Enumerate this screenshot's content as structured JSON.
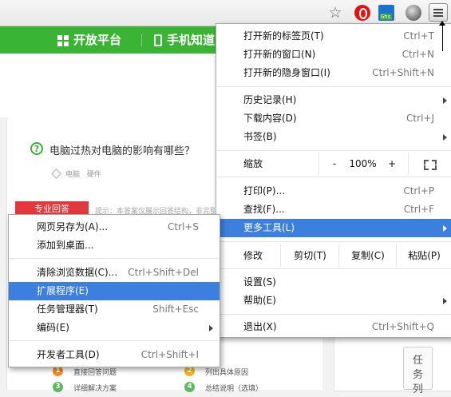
{
  "toolbar": {
    "star_icon": "star-bookmark-icon",
    "ext2_badge": "Ghs"
  },
  "site_nav": {
    "open_platform": "开放平台",
    "mobile_zhidao": "手机知道"
  },
  "question": {
    "title": "电脑过热对电脑的影响有哪些？",
    "tags": [
      "电脑",
      "硬件"
    ]
  },
  "answer": {
    "pro_tab": "专业回答",
    "hint": "提示：本答案仅展示回答结构，非完整"
  },
  "sidebar": {
    "task_button": "任务列"
  },
  "answer_steps": [
    {
      "num": "1",
      "text": "直接回答问题",
      "color": "#f08a24"
    },
    {
      "num": "2",
      "text": "列出具体原因",
      "color": "#f2b41c"
    },
    {
      "num": "3",
      "text": "详细解决方案",
      "color": "#5cb85c"
    },
    {
      "num": "4",
      "text": "总结说明（选填）",
      "color": "#5cb85c"
    }
  ],
  "chrome_menu": {
    "new_tab": {
      "label": "打开新的标签页(T)",
      "shortcut": "Ctrl+T"
    },
    "new_window": {
      "label": "打开新的窗口(N)",
      "shortcut": "Ctrl+N"
    },
    "new_incognito": {
      "label": "打开新的隐身窗口(I)",
      "shortcut": "Ctrl+Shift+N"
    },
    "history": {
      "label": "历史记录(H)"
    },
    "downloads": {
      "label": "下载内容(D)",
      "shortcut": "Ctrl+J"
    },
    "bookmarks": {
      "label": "书签(B)"
    },
    "zoom": {
      "label": "缩放",
      "minus": "-",
      "value": "100%",
      "plus": "+"
    },
    "print": {
      "label": "打印(P)...",
      "shortcut": "Ctrl+P"
    },
    "find": {
      "label": "查找(F)...",
      "shortcut": "Ctrl+F"
    },
    "more_tools": {
      "label": "更多工具(L)"
    },
    "edit": {
      "label": "修改",
      "cut": "剪切(T)",
      "copy": "复制(C)",
      "paste": "粘贴(P)"
    },
    "settings": {
      "label": "设置(S)"
    },
    "help": {
      "label": "帮助(E)"
    },
    "exit": {
      "label": "退出(X)",
      "shortcut": "Ctrl+Shift+Q"
    }
  },
  "more_tools_menu": {
    "save_as": {
      "label": "网页另存为(A)...",
      "shortcut": "Ctrl+S"
    },
    "add_to_desktop": {
      "label": "添加到桌面..."
    },
    "clear_data": {
      "label": "清除浏览数据(C)...",
      "shortcut": "Ctrl+Shift+Del"
    },
    "extensions": {
      "label": "扩展程序(E)"
    },
    "task_manager": {
      "label": "任务管理器(T)",
      "shortcut": "Shift+Esc"
    },
    "encoding": {
      "label": "编码(E)"
    },
    "devtools": {
      "label": "开发者工具(D)",
      "shortcut": "Ctrl+Shift+I"
    }
  },
  "colors": {
    "accent_green": "#3bb335",
    "highlight_blue": "#3c7fde",
    "pro_red": "#e4393c"
  }
}
